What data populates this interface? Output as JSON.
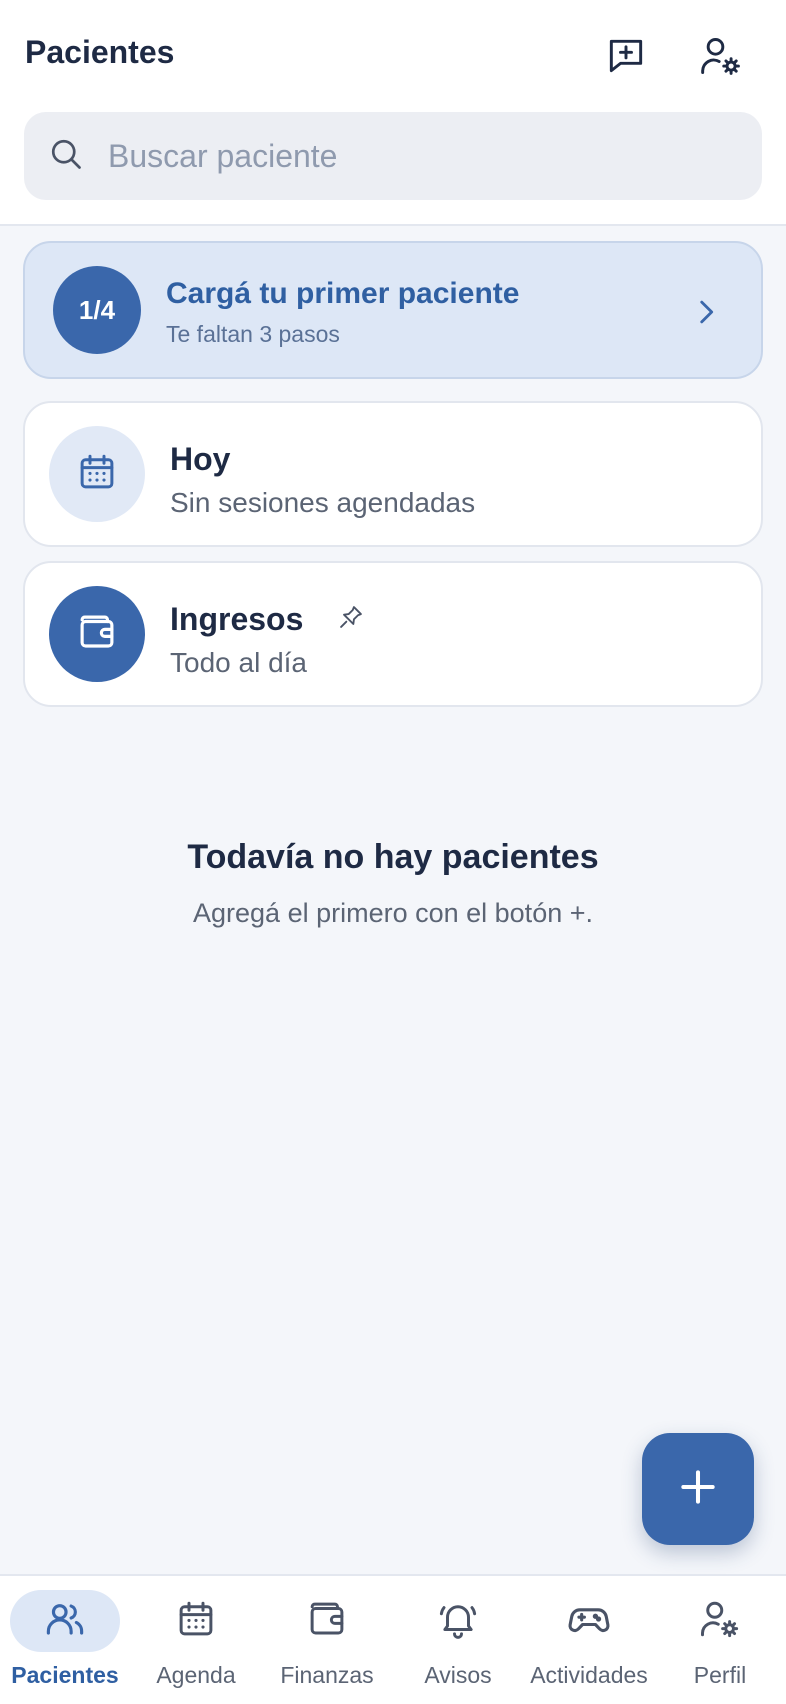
{
  "header": {
    "title": "Pacientes",
    "new_message_icon": "message-plus-icon",
    "user_settings_icon": "user-settings-icon"
  },
  "search": {
    "placeholder": "Buscar paciente",
    "value": "",
    "icon": "search-icon"
  },
  "onboarding": {
    "step": "1/4",
    "title": "Cargá tu primer paciente",
    "subtitle": "Te faltan 3 pasos"
  },
  "today_card": {
    "title": "Hoy",
    "subtitle": "Sin sesiones agendadas",
    "icon": "calendar-icon"
  },
  "income_card": {
    "title": "Ingresos",
    "subtitle": "Todo al día",
    "icon": "wallet-icon",
    "pin_icon": "pin-icon"
  },
  "empty_state": {
    "title": "Todavía no hay pacientes",
    "subtitle": "Agregá el primero con el botón +."
  },
  "fab": {
    "icon": "plus-icon"
  },
  "nav": {
    "items": [
      {
        "label": "Pacientes",
        "icon": "users-icon",
        "active": true
      },
      {
        "label": "Agenda",
        "icon": "calendar-icon",
        "active": false
      },
      {
        "label": "Finanzas",
        "icon": "wallet-icon",
        "active": false
      },
      {
        "label": "Avisos",
        "icon": "bell-icon",
        "active": false
      },
      {
        "label": "Actividades",
        "icon": "gamepad-icon",
        "active": false
      },
      {
        "label": "Perfil",
        "icon": "user-settings-icon",
        "active": false
      }
    ]
  },
  "colors": {
    "accent": "#3a67ab",
    "accent_light": "#dde7f6",
    "text": "#1e2a44",
    "muted": "#5b6474",
    "background": "#f4f6fa"
  }
}
